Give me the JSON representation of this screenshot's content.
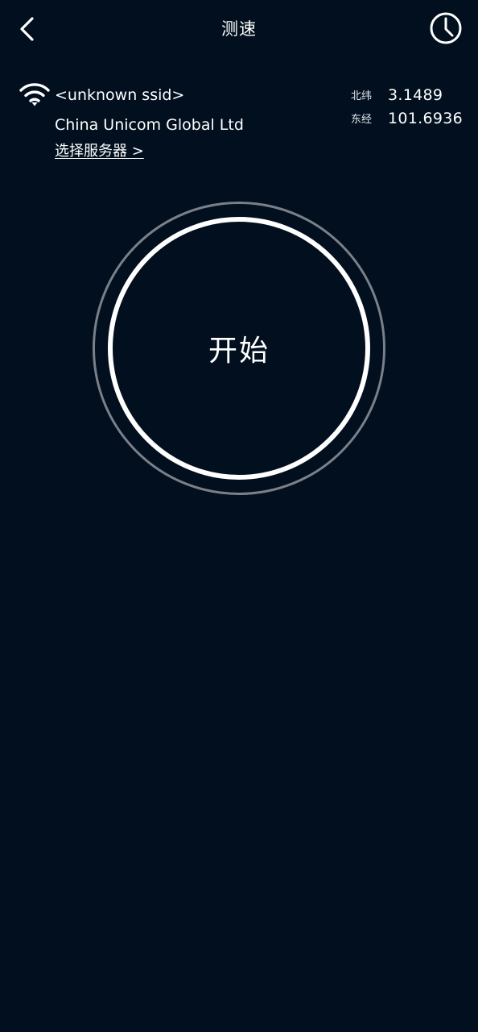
{
  "header": {
    "title": "测速",
    "back_icon": "chevron-left-icon",
    "history_icon": "clock-icon"
  },
  "network": {
    "wifi_icon": "wifi-icon",
    "ssid": "<unknown ssid>",
    "isp": "China Unicom Global Ltd",
    "select_server_label": "选择服务器 >"
  },
  "location": {
    "latitude_label": "北纬",
    "latitude_value": "3.1489",
    "longitude_label": "东经",
    "longitude_value": "101.6936"
  },
  "speedtest": {
    "start_label": "开始"
  },
  "colors": {
    "background": "#010f1e",
    "foreground": "#ffffff",
    "outer_ring": "#7a8089"
  }
}
